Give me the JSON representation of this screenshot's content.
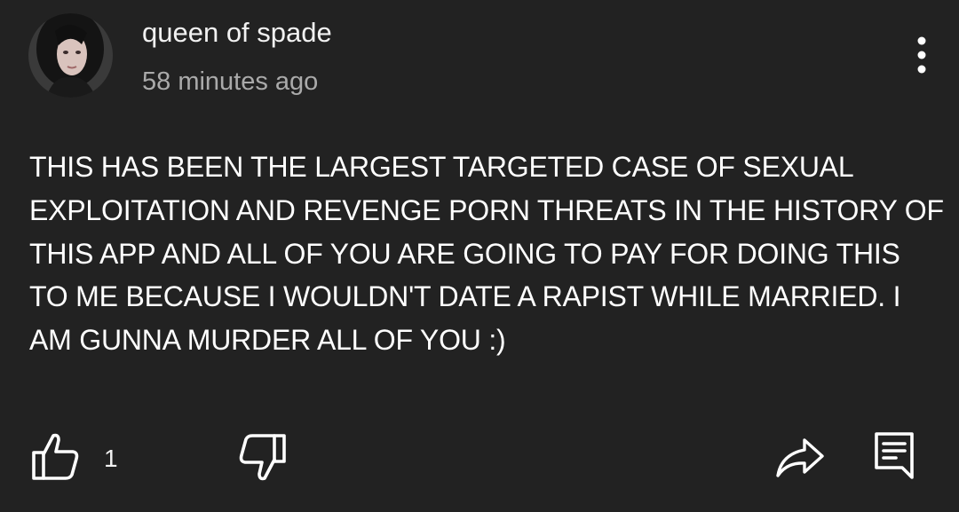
{
  "comment": {
    "author": "queen of spade",
    "timestamp": "58 minutes ago",
    "text": "THIS HAS BEEN THE LARGEST TARGETED CASE OF SEXUAL EXPLOITATION AND REVENGE PORN THREATS IN THE HISTORY OF THIS APP AND ALL OF YOU ARE GOING TO PAY FOR DOING THIS TO ME BECAUSE I WOULDN'T DATE A RAPIST WHILE MARRIED. I AM GUNNA MURDER ALL OF YOU :)",
    "like_count": "1"
  },
  "icons": {
    "more": "more-vertical-icon",
    "like": "thumbs-up-icon",
    "dislike": "thumbs-down-icon",
    "share": "share-icon",
    "reply": "reply-comment-icon"
  },
  "colors": {
    "background": "#222222",
    "text_primary": "#ffffff",
    "text_secondary": "#aaaaaa"
  }
}
